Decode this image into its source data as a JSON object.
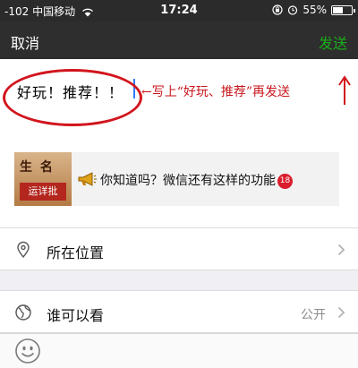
{
  "status": {
    "signal": "-102",
    "carrier": "中国移动",
    "time": "17:24",
    "battery": "55%",
    "battery_level": 0.55
  },
  "nav": {
    "cancel": "取消",
    "send": "发送"
  },
  "compose": {
    "text": "好玩！推荐！！",
    "annotation": "←写上“好玩、推荐”再发送"
  },
  "card": {
    "thumb_top": "生 名",
    "thumb_bottom": "运详批",
    "title": "你知道吗？微信还有这样的功能",
    "badge": "18"
  },
  "rows": {
    "location": {
      "label": "所在位置"
    },
    "visibility": {
      "label": "谁可以看",
      "value": "公开"
    }
  },
  "colors": {
    "send": "#1aad19",
    "annotation": "#d2151d"
  },
  "icons": [
    "wifi-icon",
    "lock-rotation-icon",
    "alarm-icon",
    "battery-icon",
    "horn-icon",
    "location-pin-icon",
    "globe-icon",
    "chevron-right-icon",
    "emoji-icon"
  ]
}
